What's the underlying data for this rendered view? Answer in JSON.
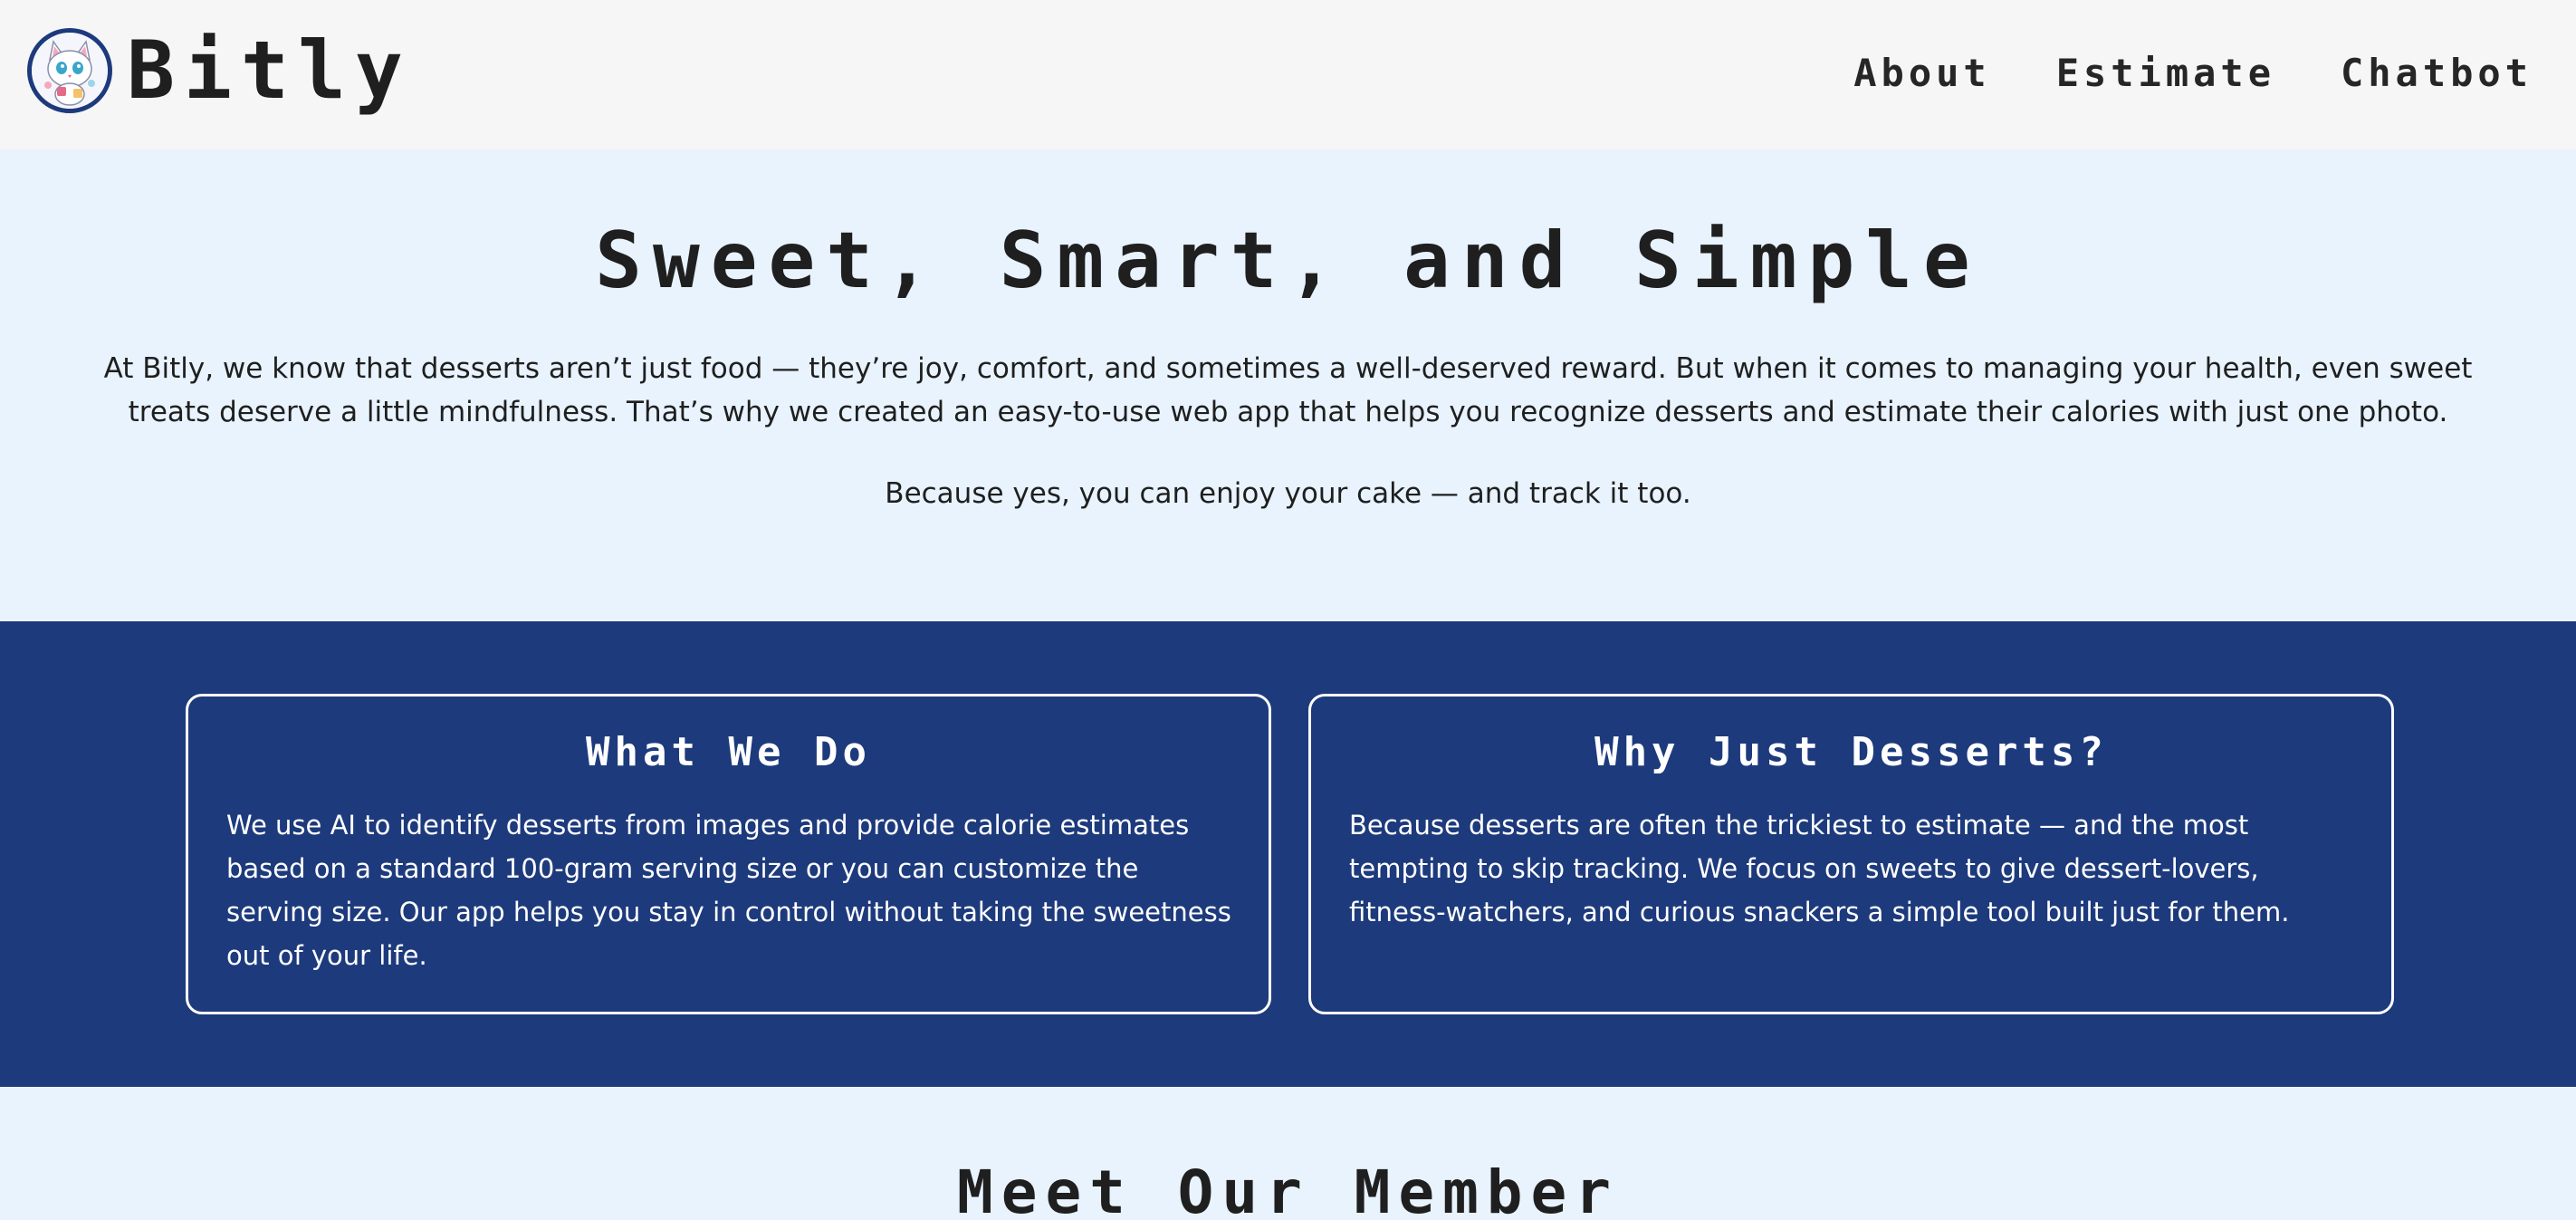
{
  "nav": {
    "brand": "Bitly",
    "links": [
      {
        "label": "About"
      },
      {
        "label": "Estimate"
      },
      {
        "label": "Chatbot"
      }
    ]
  },
  "hero": {
    "title": "Sweet, Smart, and Simple",
    "text": "At Bitly, we know that desserts aren’t just food — they’re joy, comfort, and sometimes a well-deserved reward. But when it comes to managing your health, even sweet treats deserve a little mindfulness. That’s why we created an easy-to-use web app that helps you recognize desserts and estimate their calories with just one photo.",
    "tagline": "Because yes, you can enjoy your cake — and track it too."
  },
  "features": {
    "what_we_do": {
      "title": "What We Do",
      "body": "We use AI to identify desserts from images and provide calorie estimates based on a standard 100-gram serving size or you can customize the serving size. Our app helps you stay in control without taking the sweetness out of your life."
    },
    "why_desserts": {
      "title": "Why Just Desserts?",
      "body": "Because desserts are often the trickiest to estimate — and the most tempting to skip tracking. We focus on sweets to give dessert-lovers, fitness-watchers, and curious snackers a simple tool built just for them."
    }
  },
  "members": {
    "title": "Meet Our Member"
  },
  "colors": {
    "nav_bg": "#f6f6f6",
    "page_bg": "#e8f3fd",
    "feature_bg": "#1d3a7c",
    "text_dark": "#1f1f1f"
  },
  "icons": {
    "logo": "cat-logo"
  }
}
